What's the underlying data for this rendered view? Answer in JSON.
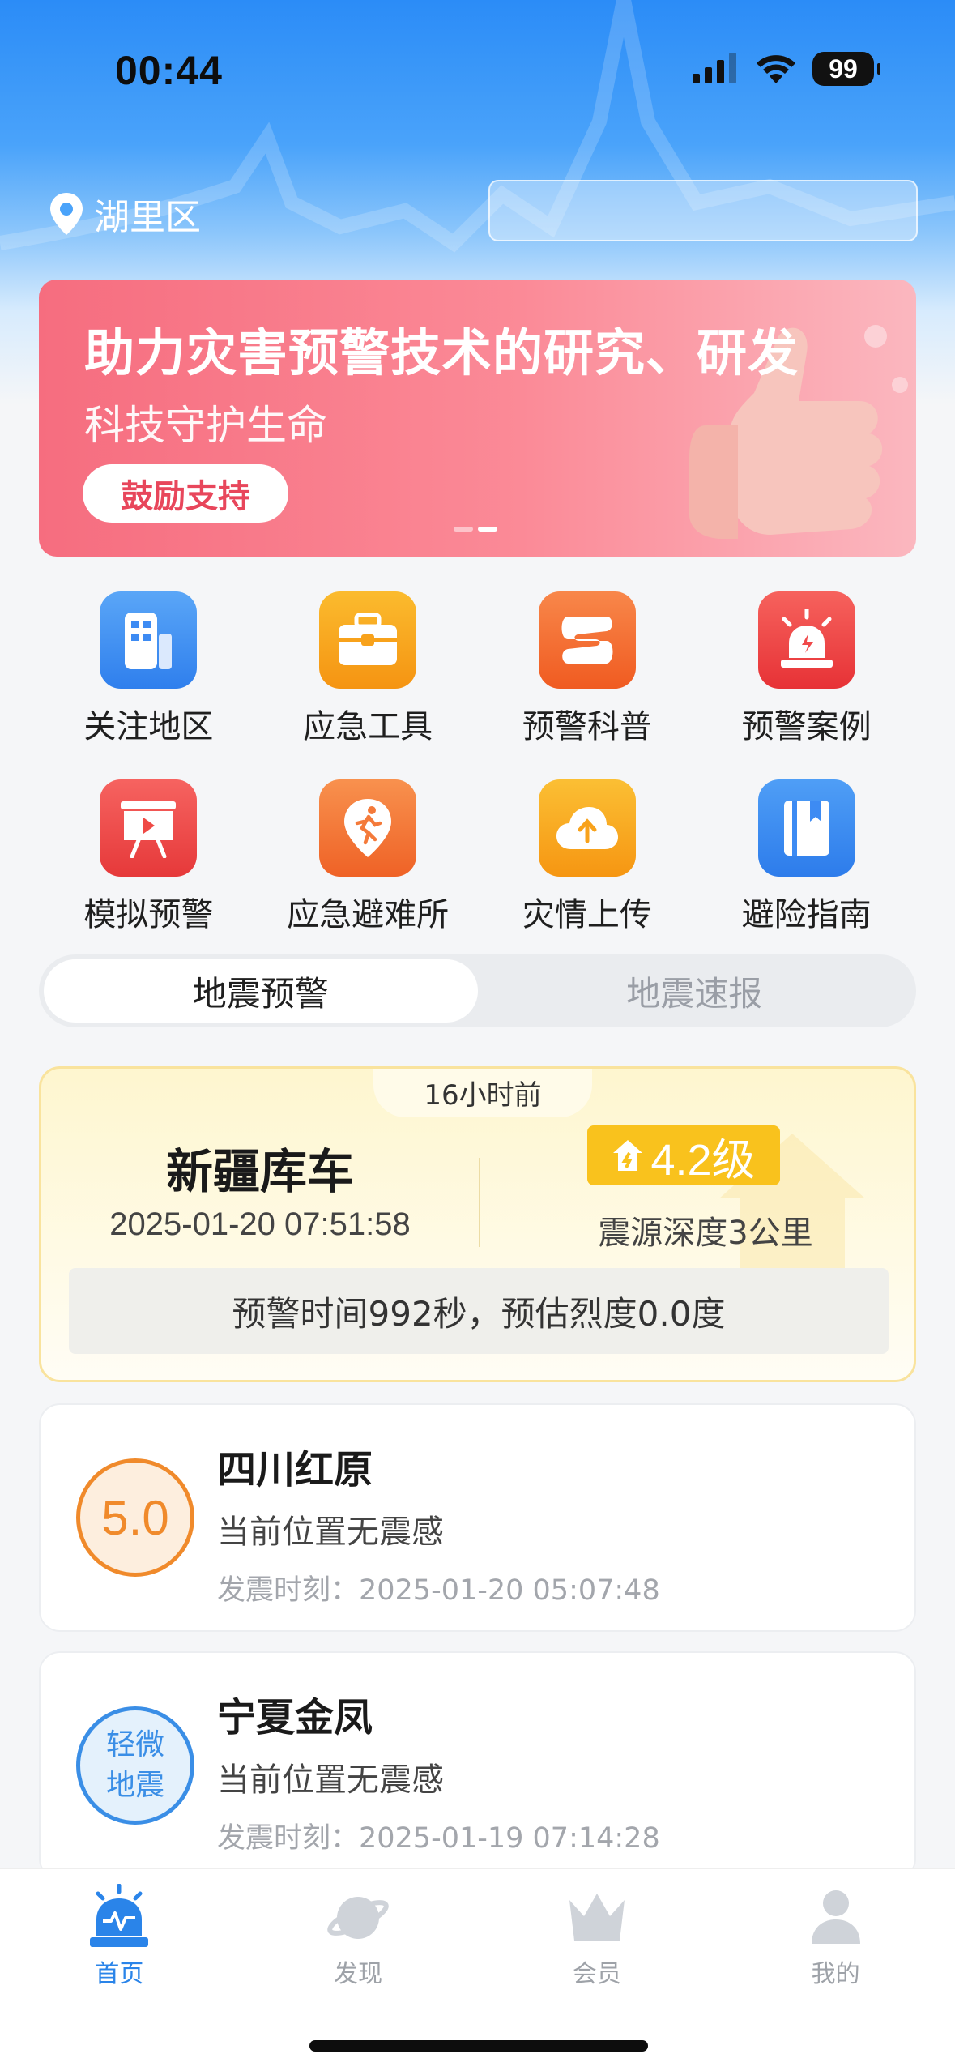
{
  "status_bar": {
    "time": "00:44",
    "battery": "99"
  },
  "header": {
    "location": "湖里区"
  },
  "banner": {
    "title": "助力灾害预警技术的研究、研发",
    "subtitle": "科技守护生命",
    "button": "鼓励支持"
  },
  "grid": [
    {
      "label": "关注地区",
      "icon": "buildings-icon",
      "color": "#3d8bf3"
    },
    {
      "label": "应急工具",
      "icon": "toolbox-icon",
      "color": "#f8a21b"
    },
    {
      "label": "预警科普",
      "icon": "book-s-icon",
      "color": "#f4722f"
    },
    {
      "label": "预警案例",
      "icon": "alarm-light-icon",
      "color": "#f0494a"
    },
    {
      "label": "模拟预警",
      "icon": "presentation-icon",
      "color": "#ef4a46"
    },
    {
      "label": "应急避难所",
      "icon": "running-person-icon",
      "color": "#f47a3a"
    },
    {
      "label": "灾情上传",
      "icon": "cloud-upload-icon",
      "color": "#f9a71c"
    },
    {
      "label": "避险指南",
      "icon": "guide-book-icon",
      "color": "#3d8bf3"
    }
  ],
  "tabs": [
    {
      "label": "地震预警",
      "active": true
    },
    {
      "label": "地震速报",
      "active": false
    }
  ],
  "featured": {
    "ago": "16小时前",
    "place": "新疆库车",
    "time": "2025-01-20 07:51:58",
    "magnitude": "4.2级",
    "depth": "震源深度3公里",
    "warning": "预警时间992秒，预估烈度0.0度"
  },
  "quakes": [
    {
      "badge": "5.0",
      "name": "四川红原",
      "feel": "当前位置无震感",
      "time": "发震时刻：2025-01-20 05:07:48"
    },
    {
      "badge_line1": "轻微",
      "badge_line2": "地震",
      "name": "宁夏金凤",
      "feel": "当前位置无震感",
      "time": "发震时刻：2025-01-19 07:14:28"
    }
  ],
  "bottom_nav": [
    {
      "label": "首页",
      "icon": "home-alarm-icon",
      "active": true
    },
    {
      "label": "发现",
      "icon": "planet-icon",
      "active": false
    },
    {
      "label": "会员",
      "icon": "crown-icon",
      "active": false
    },
    {
      "label": "我的",
      "icon": "user-icon",
      "active": false
    }
  ]
}
